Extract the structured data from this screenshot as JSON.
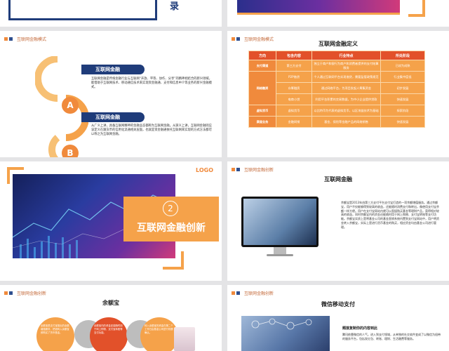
{
  "slide1": {
    "char": "录"
  },
  "slide3": {
    "section": "互联网金融模式",
    "items": [
      {
        "letter": "A",
        "title": "互联网金融",
        "text": "互联网金融是传统金融行业与互联网“开放、平等、协作、分享”的精神相结合的新兴领域，能借助于互联网技术、移动通信技术来实现资金融通、支付和信息中介等业务的新兴金融模式。"
      },
      {
        "letter": "B",
        "title": "互联网金融",
        "text": "从广义上讲，具备互联网精神的金融业态都称为互联网金融。从狭义上讲，互联网金融则应该定义在跟货币的信用化流通相关层面，也就是资金融通依托互联网来实现的方式方法都可以称之为互联网金融。"
      }
    ]
  },
  "slide4": {
    "section": "互联网金融模式",
    "title": "互联网金融定义",
    "headers": [
      "方向",
      "包含内容",
      "行业特点",
      "所处阶段"
    ],
    "rows": [
      {
        "cat": "支付渠道",
        "content": "第三方支付",
        "feature": "独立于商户和银行为商户和消费者提供的支付结算服务",
        "stage": "已较为成熟"
      },
      {
        "cat": "网络融资",
        "content": "P2P借贷",
        "feature": "个人通过互联网平台实现借贷，需要监管政策规范",
        "stage": "行业集中度低"
      },
      {
        "cat": "",
        "content": "众筹融资",
        "feature": "通过网络平台，为项目发起人筹集资金",
        "stage": "初步发展"
      },
      {
        "cat": "",
        "content": "电商小贷",
        "feature": "利用平台积累的交易数据，为中小企业提供贷款",
        "stage": "快速发展"
      },
      {
        "cat": "虚拟货币",
        "content": "虚拟货币",
        "feature": "以比特币为代表的虚拟货币，以区块链技术为基础",
        "stage": "探索阶段"
      },
      {
        "cat": "渠道业务",
        "content": "金融网销",
        "feature": "基金、保险等金融产品的网络销售",
        "stage": "快速发展"
      }
    ]
  },
  "slide5": {
    "logo": "LOGO",
    "num": "2",
    "title": "互联网金融创新"
  },
  "slide6": {
    "section": "互联网金融创新",
    "title": "互联网金融",
    "text": "余额宝是2013年由第三方支付平台支付宝打造的一项余额增值服务。通过余额宝，用户不仅能够得到较高的收益，还能随时消费支付和转出，像使用支付宝余额一样方便。用户在支付宝网站内就可以直接购买基金等理财产品，获得相对较高的收益，同时余额宝内的资金还能随时用于网上购物、支付宝转账等支付功能。余额宝实质上是将基金公司的基金直销系统内置到支付宝网站中，用户将资金转入余额宝，实际上是进行货币基金的购买，相应资金均由基金公司进行管理。"
  },
  "slide7": {
    "section": "互联网金融创新",
    "title": "余额宝",
    "bubbles": [
      "余额宝是支付宝推出的余额增值服务，把钱转入余额宝即购买了货币基金。",
      "余额宝内的资金还能随时用于网上购物、支付宝转账等支付功能。",
      "转入余额宝的资金在第二个工作日由基金公司进行份额确认。"
    ]
  },
  "slide8": {
    "section": "互联网金融创新",
    "title": "微信移动支付",
    "subtitle": "题接复制你的内容到此",
    "text": "腾讯依靠微信的人气，进入到支付领域，从单独的社交软件变成了以微信为纽带的服务平台，包括发红包、转账、理财、生活缴费等服务。"
  },
  "colors": {
    "orange": "#f08a3c",
    "navy": "#1f3c7a",
    "red": "#e2512a"
  }
}
